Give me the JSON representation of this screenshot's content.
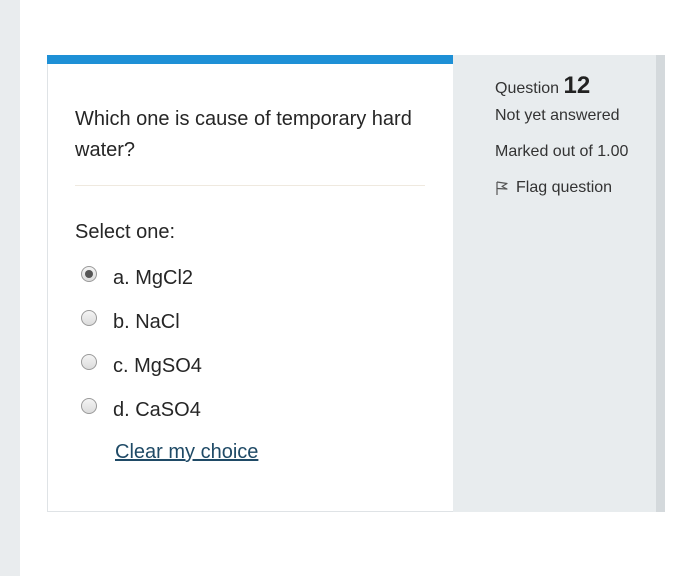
{
  "question": {
    "text": "Which one is cause of temporary hard water?",
    "prompt": "Select one:",
    "options": [
      {
        "label": "a. MgCl2",
        "checked": true
      },
      {
        "label": "b. NaCl",
        "checked": false
      },
      {
        "label": "c. MgSO4",
        "checked": false
      },
      {
        "label": "d. CaSO4",
        "checked": false
      }
    ],
    "clear_label": "Clear my choice"
  },
  "info": {
    "question_label": "Question",
    "question_number": "12",
    "status": "Not yet answered",
    "marks": "Marked out of 1.00",
    "flag_label": "Flag question",
    "flag_icon": "flag-icon"
  },
  "colors": {
    "accent": "#1e90d6",
    "panel_bg": "#e8ecee",
    "link": "#1f4a66"
  }
}
